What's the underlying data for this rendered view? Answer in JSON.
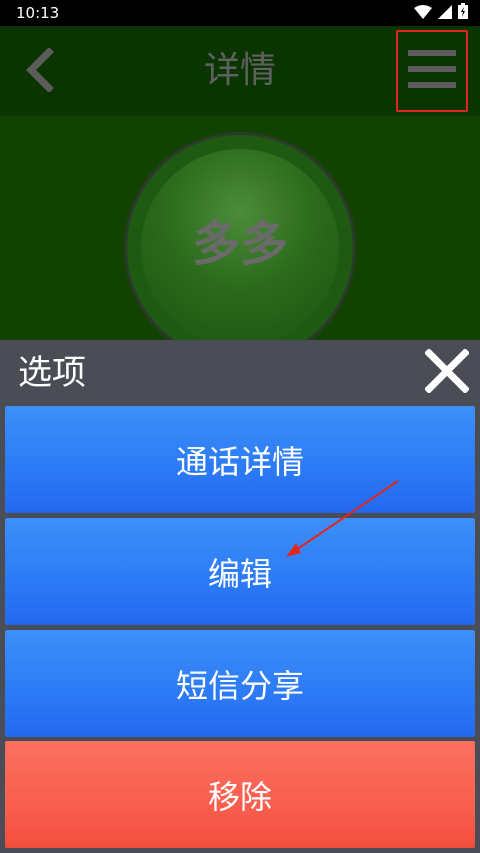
{
  "status_bar": {
    "time": "10:13",
    "icons": [
      "wifi-icon",
      "signal-icon",
      "battery-icon"
    ]
  },
  "app_bar": {
    "title": "详情",
    "back_icon": "chevron-left-icon",
    "menu_icon": "hamburger-menu-icon"
  },
  "contact": {
    "avatar_text": "多多"
  },
  "options_sheet": {
    "title": "选项",
    "close_icon": "close-icon",
    "items": [
      {
        "label": "通话详情",
        "color": "#2d7cf7"
      },
      {
        "label": "编辑",
        "color": "#2d7cf7"
      },
      {
        "label": "短信分享",
        "color": "#2d7cf7"
      },
      {
        "label": "移除",
        "color": "#f96050"
      }
    ]
  },
  "colors": {
    "app_bar_bg": "#0a3500",
    "header_bg": "#114200",
    "sheet_bg": "#4b4d56",
    "highlight_border": "#e3261d",
    "annotation_arrow": "#e3261d"
  }
}
